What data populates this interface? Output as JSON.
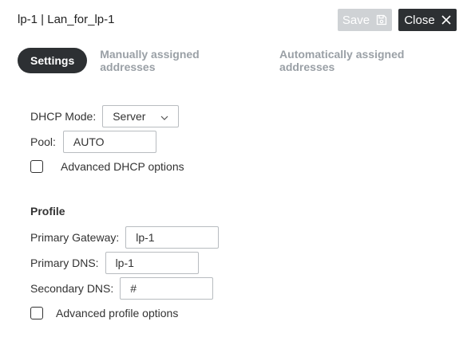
{
  "header": {
    "title": "lp-1 | Lan_for_lp-1",
    "save_label": "Save",
    "close_label": "Close"
  },
  "tabs": [
    {
      "label": "Settings",
      "active": true
    },
    {
      "label": "Manually assigned addresses",
      "active": false
    },
    {
      "label": "Automatically assigned addresses",
      "active": false
    }
  ],
  "dhcp": {
    "mode_label": "DHCP Mode:",
    "mode_value": "Server",
    "pool_label": "Pool:",
    "pool_value": "AUTO",
    "advanced_label": "Advanced DHCP options",
    "advanced_checked": false
  },
  "profile": {
    "section_title": "Profile",
    "primary_gateway_label": "Primary Gateway:",
    "primary_gateway_value": "lp-1",
    "primary_dns_label": "Primary DNS:",
    "primary_dns_value": "lp-1",
    "secondary_dns_label": "Secondary DNS:",
    "secondary_dns_value": "#",
    "advanced_label": "Advanced profile options",
    "advanced_checked": false
  },
  "colors": {
    "dark": "#2d3033",
    "disabled": "#cfd2d5",
    "tab_inactive": "#9aa0a6"
  }
}
